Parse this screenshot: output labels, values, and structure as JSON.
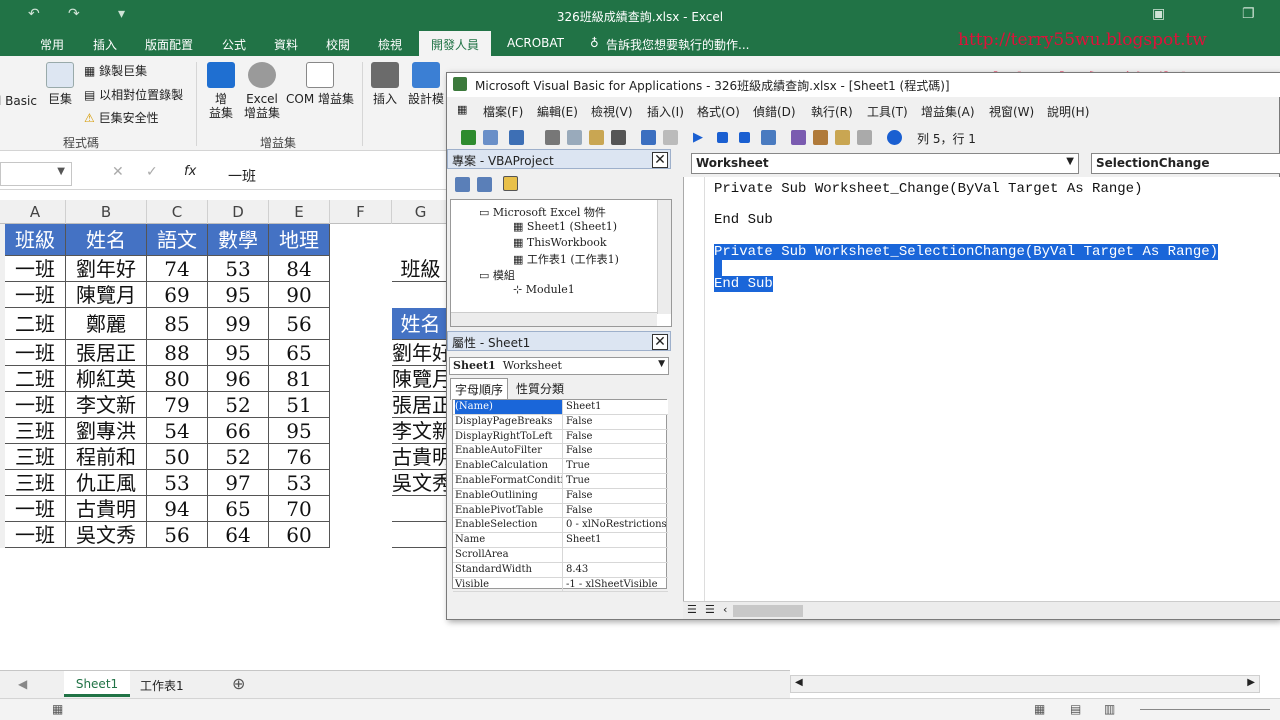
{
  "excel": {
    "title": "326班級成績查詢.xlsx - Excel",
    "tabs": [
      "常用",
      "插入",
      "版面配置",
      "公式",
      "資料",
      "校閱",
      "檢視",
      "開發人員",
      "ACROBAT"
    ],
    "tell_me": "告訴我您想要執行的動作...",
    "ribbon": {
      "basic": "l Basic",
      "macros": "巨集",
      "record_macro": "錄製巨集",
      "relative_ref": "以相對位置錄製",
      "macro_security": "巨集安全性",
      "group_code": "程式碼",
      "addins": "增\n益集",
      "excel_addins": "Excel\n增益集",
      "com_addins": "COM 增益集",
      "group_addins": "增益集",
      "insert": "插入",
      "design": "設計模"
    },
    "formula_value": "一班",
    "fx": "fx",
    "columns": [
      "A",
      "B",
      "C",
      "D",
      "E",
      "F",
      "G"
    ],
    "header": [
      "班級",
      "姓名",
      "語文",
      "數學",
      "地理"
    ],
    "rows": [
      [
        "一班",
        "劉年好",
        "74",
        "53",
        "84"
      ],
      [
        "一班",
        "陳覽月",
        "69",
        "95",
        "90"
      ],
      [
        "二班",
        "鄭麗",
        "85",
        "99",
        "56"
      ],
      [
        "一班",
        "張居正",
        "88",
        "95",
        "65"
      ],
      [
        "二班",
        "柳紅英",
        "80",
        "96",
        "81"
      ],
      [
        "一班",
        "李文新",
        "79",
        "52",
        "51"
      ],
      [
        "三班",
        "劉專洪",
        "54",
        "66",
        "95"
      ],
      [
        "三班",
        "程前和",
        "50",
        "52",
        "76"
      ],
      [
        "三班",
        "仇正風",
        "53",
        "97",
        "53"
      ],
      [
        "一班",
        "古貴明",
        "94",
        "65",
        "70"
      ],
      [
        "一班",
        "吳文秀",
        "56",
        "64",
        "60"
      ]
    ],
    "g_col": {
      "g1": "班級",
      "g3": "姓名",
      "list": [
        "劉年好",
        "陳覽月",
        "張居正",
        "李文新",
        "古貴明",
        "吳文秀"
      ]
    },
    "sheet_tabs": [
      "Sheet1",
      "工作表1"
    ]
  },
  "vbe": {
    "title": "Microsoft Visual Basic for Applications - 326班級成績查詢.xlsx - [Sheet1 (程式碼)]",
    "menus": [
      "檔案(F)",
      "編輯(E)",
      "檢視(V)",
      "插入(I)",
      "格式(O)",
      "偵錯(D)",
      "執行(R)",
      "工具(T)",
      "增益集(A)",
      "視窗(W)",
      "說明(H)"
    ],
    "position": "列 5，行 1",
    "project_title": "專案 - VBAProject",
    "tree": [
      "Microsoft Excel 物件",
      "Sheet1 (Sheet1)",
      "ThisWorkbook",
      "工作表1 (工作表1)",
      "模組",
      "Module1"
    ],
    "props_title": "屬性 - Sheet1",
    "props_object": "Sheet1",
    "props_object_type": "Worksheet",
    "props_tabs": [
      "字母順序",
      "性質分類"
    ],
    "props": [
      [
        "(Name)",
        "Sheet1"
      ],
      [
        "DisplayPageBreaks",
        "False"
      ],
      [
        "DisplayRightToLeft",
        "False"
      ],
      [
        "EnableAutoFilter",
        "False"
      ],
      [
        "EnableCalculation",
        "True"
      ],
      [
        "EnableFormatCondition",
        "True"
      ],
      [
        "EnableOutlining",
        "False"
      ],
      [
        "EnablePivotTable",
        "False"
      ],
      [
        "EnableSelection",
        "0 - xlNoRestrictions"
      ],
      [
        "Name",
        "Sheet1"
      ],
      [
        "ScrollArea",
        ""
      ],
      [
        "StandardWidth",
        "8.43"
      ],
      [
        "Visible",
        "-1 - xlSheetVisible"
      ]
    ],
    "object_dropdown": "Worksheet",
    "proc_dropdown": "SelectionChange",
    "code": [
      "Private Sub Worksheet_Change(ByVal Target As Range)",
      "End Sub",
      "Private Sub Worksheet_SelectionChange(ByVal Target As Range)",
      "End Sub"
    ]
  },
  "overlay": {
    "url": "http://terry55wu.blogspot.tw",
    "credit": "吳清輝老師錄製"
  },
  "colors": {
    "excel_green": "#217346",
    "header_blue": "#4472c4",
    "selection": "#1a66d9",
    "watermark": "#e0103a"
  }
}
